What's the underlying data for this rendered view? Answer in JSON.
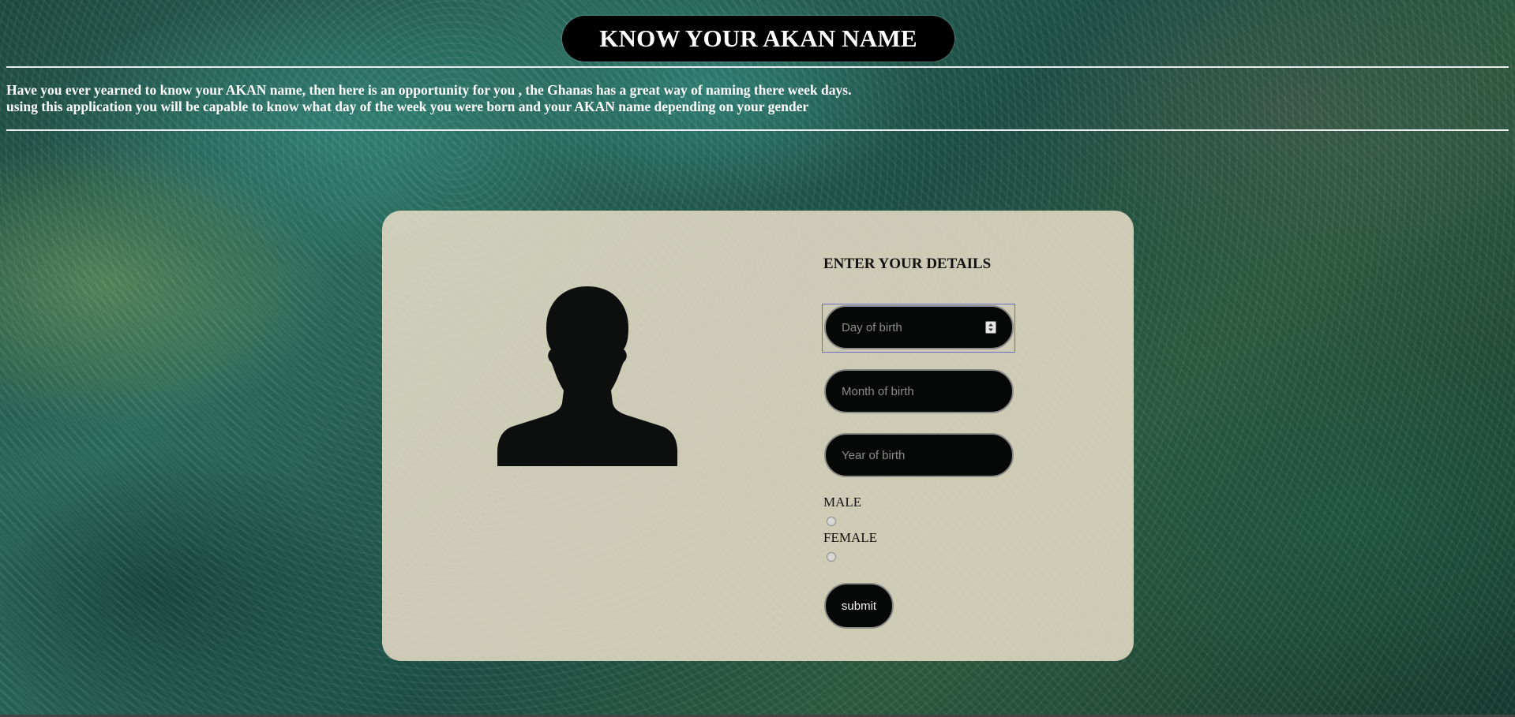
{
  "header": {
    "title": "KNOW YOUR AKAN NAME"
  },
  "intro": {
    "line1": "Have you ever yearned to know your AKAN name, then here is an opportunity for you , the Ghanas has a great way of naming there week days.",
    "line2": "using this application you will be capable to know what day of the week you were born and your AKAN name depending on your gender"
  },
  "form": {
    "heading": "ENTER YOUR DETAILS",
    "day": {
      "placeholder": "Day of birth",
      "value": ""
    },
    "month": {
      "placeholder": "Month of birth",
      "value": ""
    },
    "year": {
      "placeholder": "Year of birth",
      "value": ""
    },
    "gender": {
      "male_label": "MALE",
      "female_label": "FEMALE",
      "selected": null
    },
    "submit_label": "submit"
  },
  "icons": {
    "avatar": "person-silhouette-icon",
    "spinner": "number-spinner-icon"
  },
  "colors": {
    "title_bg": "#000000",
    "title_text": "#ffffff",
    "card_bg": "#e9dec8",
    "input_bg": "#050807",
    "focus_outline": "#6c6cc8"
  }
}
